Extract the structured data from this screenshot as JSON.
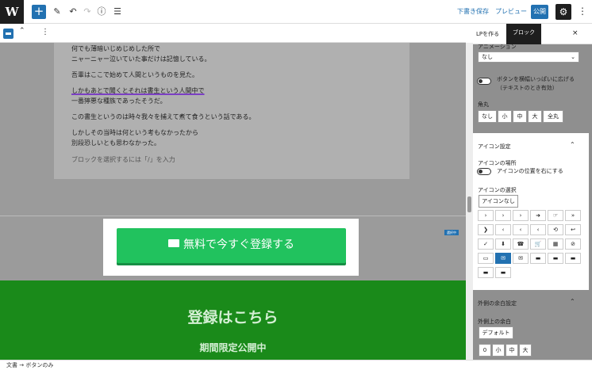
{
  "topbar": {
    "logo": "W",
    "add": "+",
    "edit_icon": "✎",
    "undo_icon": "↶",
    "redo_icon": "↷",
    "info_icon": "ⓘ",
    "list_icon": "☰",
    "draft_save": "下書き保存",
    "preview": "プレビュー",
    "publish": "公開",
    "settings_icon": "⚙",
    "more_icon": "⋮"
  },
  "block_toolbar": {
    "move_icon": "⌃",
    "more_icon": "⋮"
  },
  "content": {
    "lines": [
      "何でも薄暗いじめじめした所で",
      "ニャーニャー泣いていた事だけは記憶している。",
      "吾輩はここで始めて人間というものを見た。",
      "しかもあとで聞くとそれは書生という人間中で",
      "一番獰悪な種族であったそうだ。",
      "この書生というのは時々我々を捕えて煮て食うという話である。",
      "しかしその当時は何という考もなかったから",
      "別段恐しいとも思わなかった。"
    ],
    "placeholder": "ブロックを選択するには「/」を入力",
    "badge": "選択中",
    "cta_label": "無料で今すぐ登録する",
    "register_heading": "登録はこちら",
    "register_sub": "期間限定公開中"
  },
  "sidebar": {
    "tabs": [
      "LPを作る",
      "ブロック"
    ],
    "close": "×",
    "animation_label": "アニメーション",
    "animation_value": "なし",
    "fullwidth_label": "ボタンを横幅いっぱいに広げる",
    "fullwidth_sub": "（テキストのとき有効）",
    "radius_label": "角丸",
    "radius_options": [
      "なし",
      "小",
      "中",
      "大",
      "全丸"
    ],
    "icon_settings": "アイコン設定",
    "icon_position_label": "アイコンの場所",
    "icon_position_toggle": "アイコンの位置を右にする",
    "icon_select_label": "アイコンの選択",
    "icon_none": "アイコンなし",
    "icons": [
      "›",
      "›",
      "›",
      "➜",
      "☞",
      "»",
      "❯",
      "‹",
      "‹",
      "‹",
      "⟲",
      "↩",
      "✓",
      "⬇",
      "☎",
      "🛒",
      "▦",
      "⊘",
      "▭",
      "✉",
      "✉",
      "▬",
      "▬",
      "▬",
      "▬",
      "▬"
    ],
    "margin_settings": "外側の余白設定",
    "margin_top_label": "外側上の余白",
    "margin_default": "デフォルト",
    "margin_options": [
      "0",
      "小",
      "中",
      "大"
    ]
  },
  "status": {
    "breadcrumb": "文書 → ボタンのみ"
  }
}
